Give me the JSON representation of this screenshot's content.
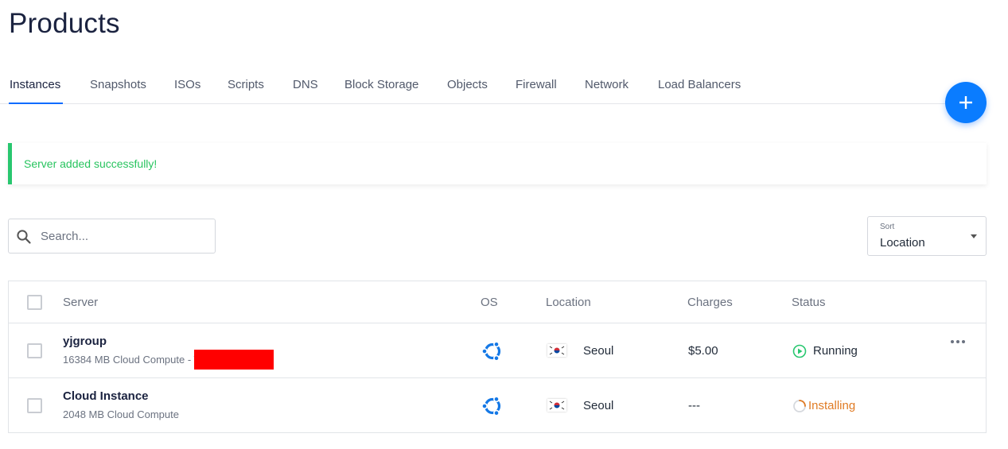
{
  "page": {
    "title": "Products"
  },
  "tabs": [
    {
      "label": "Instances",
      "active": true
    },
    {
      "label": "Snapshots"
    },
    {
      "label": "ISOs"
    },
    {
      "label": "Scripts"
    },
    {
      "label": "DNS"
    },
    {
      "label": "Block Storage"
    },
    {
      "label": "Objects"
    },
    {
      "label": "Firewall"
    },
    {
      "label": "Network"
    },
    {
      "label": "Load Balancers"
    }
  ],
  "fab": {
    "icon": "plus-icon",
    "color": "#0a7cff"
  },
  "alert": {
    "message": "Server added successfully!",
    "color": "#28c76f"
  },
  "search": {
    "placeholder": "Search...",
    "value": "",
    "icon": "search-icon"
  },
  "sort": {
    "label": "Sort",
    "value": "Location"
  },
  "table": {
    "headers": {
      "server": "Server",
      "os": "OS",
      "location": "Location",
      "charges": "Charges",
      "status": "Status"
    },
    "rows": [
      {
        "name": "yjgroup",
        "desc": "16384 MB Cloud Compute - T",
        "os_icon": "ubuntu-icon",
        "flag_icon": "south-korea-flag-icon",
        "location": "Seoul",
        "charges": "$5.00",
        "status": "Running",
        "status_color": "#1f2937",
        "status_icon": "play-circle-icon"
      },
      {
        "name": "Cloud Instance",
        "desc": "2048 MB Cloud Compute",
        "os_icon": "ubuntu-icon",
        "flag_icon": "south-korea-flag-icon",
        "location": "Seoul",
        "charges": "---",
        "status": "Installing",
        "status_color": "#e07b24",
        "status_icon": "spinner-icon"
      }
    ]
  }
}
